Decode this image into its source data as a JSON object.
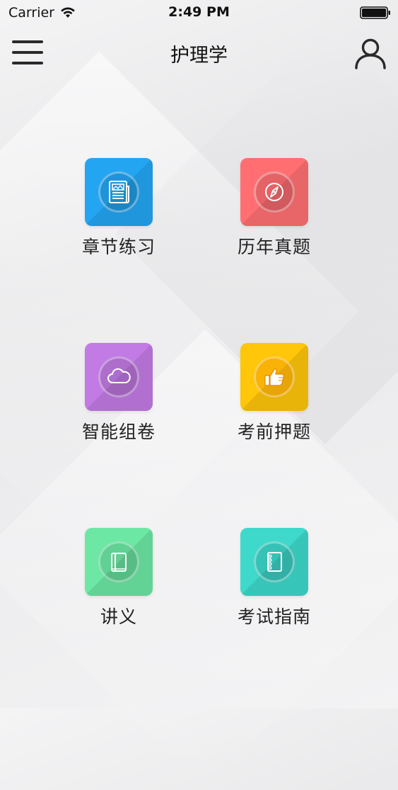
{
  "status_bar": {
    "carrier": "Carrier",
    "time": "2:49 PM"
  },
  "nav": {
    "title": "护理学",
    "menu_icon": "hamburger-menu-icon",
    "user_icon": "user-profile-icon"
  },
  "tiles": [
    {
      "label": "章节练习",
      "icon": "newspaper-icon",
      "color": "#23A5F2"
    },
    {
      "label": "历年真题",
      "icon": "compass-icon",
      "color": "#FF6F72"
    },
    {
      "label": "智能组卷",
      "icon": "cloud-icon",
      "color": "#C27BE4"
    },
    {
      "label": "考前押题",
      "icon": "thumbs-up-icon",
      "color": "#FFC60A"
    },
    {
      "label": "讲义",
      "icon": "book-icon",
      "color": "#6CE8A4"
    },
    {
      "label": "考试指南",
      "icon": "notebook-icon",
      "color": "#3ED9CB"
    }
  ]
}
